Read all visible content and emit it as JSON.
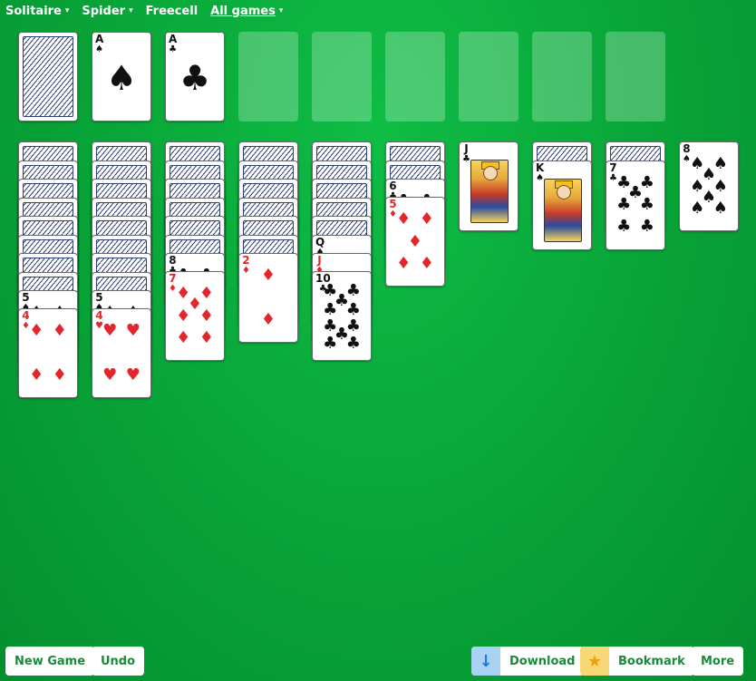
{
  "nav": [
    {
      "label": "Solitaire",
      "caret": "▾"
    },
    {
      "label": "Spider",
      "caret": "▾"
    },
    {
      "label": "Freecell",
      "caret": ""
    },
    {
      "label": "All games",
      "caret": "▾"
    }
  ],
  "foundations": [
    {
      "rank": "A",
      "suit": "♠",
      "color": "black"
    },
    {
      "rank": "A",
      "suit": "♣",
      "color": "black"
    }
  ],
  "tableau": [
    {
      "face_down": 8,
      "cards": [
        {
          "rank": "5",
          "suit": "♠",
          "color": "black"
        },
        {
          "rank": "4",
          "suit": "♦",
          "color": "red"
        }
      ]
    },
    {
      "face_down": 8,
      "cards": [
        {
          "rank": "5",
          "suit": "♠",
          "color": "black"
        },
        {
          "rank": "4",
          "suit": "♥",
          "color": "red"
        }
      ]
    },
    {
      "face_down": 6,
      "cards": [
        {
          "rank": "8",
          "suit": "♣",
          "color": "black"
        },
        {
          "rank": "7",
          "suit": "♦",
          "color": "red"
        }
      ]
    },
    {
      "face_down": 6,
      "cards": [
        {
          "rank": "2",
          "suit": "♦",
          "color": "red"
        }
      ]
    },
    {
      "face_down": 5,
      "cards": [
        {
          "rank": "Q",
          "suit": "♠",
          "color": "black"
        },
        {
          "rank": "J",
          "suit": "♦",
          "color": "red"
        },
        {
          "rank": "10",
          "suit": "♣",
          "color": "black"
        }
      ]
    },
    {
      "face_down": 2,
      "cards": [
        {
          "rank": "6",
          "suit": "♣",
          "color": "black"
        },
        {
          "rank": "5",
          "suit": "♦",
          "color": "red"
        }
      ]
    },
    {
      "face_down": 0,
      "cards": [
        {
          "rank": "J",
          "suit": "♣",
          "color": "black"
        }
      ]
    },
    {
      "face_down": 1,
      "cards": [
        {
          "rank": "K",
          "suit": "♠",
          "color": "black"
        }
      ]
    },
    {
      "face_down": 1,
      "cards": [
        {
          "rank": "7",
          "suit": "♣",
          "color": "black"
        }
      ]
    },
    {
      "face_down": 0,
      "cards": [
        {
          "rank": "8",
          "suit": "♠",
          "color": "black"
        }
      ]
    }
  ],
  "buttons": {
    "new_game": "New Game",
    "undo": "Undo",
    "download": "Download",
    "bookmark": "Bookmark",
    "more": "More"
  },
  "icons": {
    "download": "↓",
    "bookmark": "★"
  }
}
